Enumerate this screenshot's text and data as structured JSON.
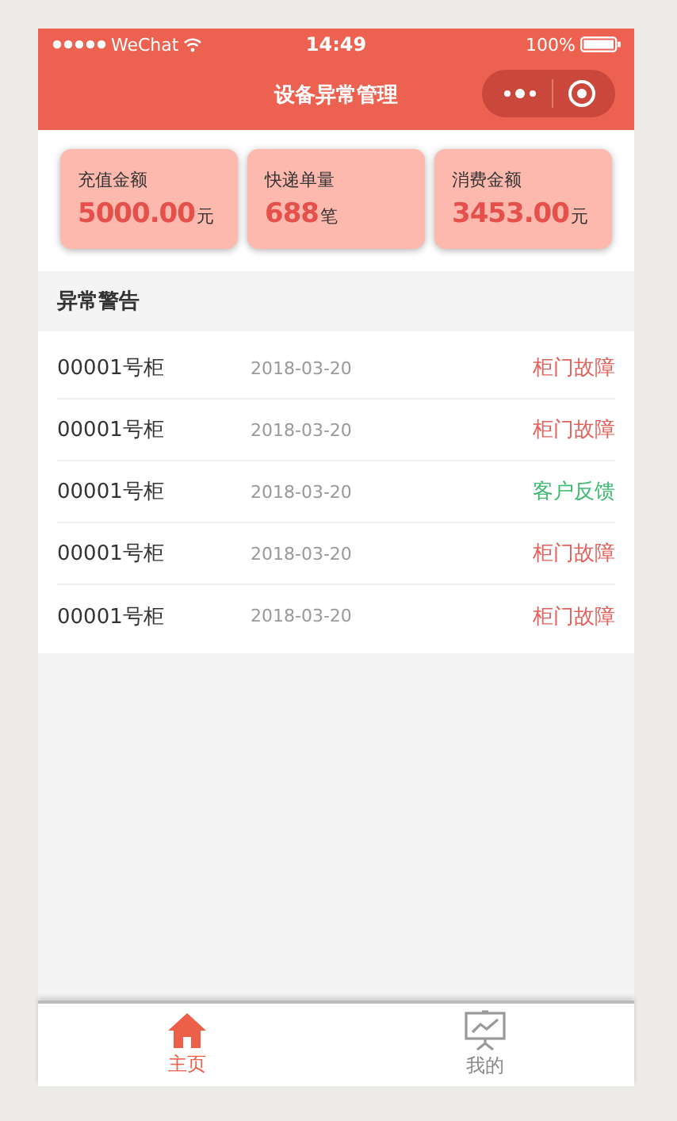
{
  "status_bar": {
    "carrier": "WeChat",
    "time": "14:49",
    "battery": "100%"
  },
  "nav": {
    "title": "设备异常管理"
  },
  "stats": [
    {
      "label": "充值金额",
      "value": "5000.00",
      "unit": "元"
    },
    {
      "label": "快递单量",
      "value": "688",
      "unit": "笔"
    },
    {
      "label": "消费金额",
      "value": "3453.00",
      "unit": "元"
    }
  ],
  "section": {
    "title": "异常警告"
  },
  "alerts": [
    {
      "cabinet": "00001号柜",
      "date": "2018-03-20",
      "status": "柜门故障",
      "color": "#e5605a"
    },
    {
      "cabinet": "00001号柜",
      "date": "2018-03-20",
      "status": "柜门故障",
      "color": "#e5605a"
    },
    {
      "cabinet": "00001号柜",
      "date": "2018-03-20",
      "status": "客户反馈",
      "color": "#3dba6f"
    },
    {
      "cabinet": "00001号柜",
      "date": "2018-03-20",
      "status": "柜门故障",
      "color": "#e5605a"
    },
    {
      "cabinet": "00001号柜",
      "date": "2018-03-20",
      "status": "柜门故障",
      "color": "#e5605a"
    }
  ],
  "tabs": [
    {
      "label": "主页",
      "kind": "home",
      "selected": true
    },
    {
      "label": "我的",
      "kind": "chart",
      "selected": false
    }
  ]
}
